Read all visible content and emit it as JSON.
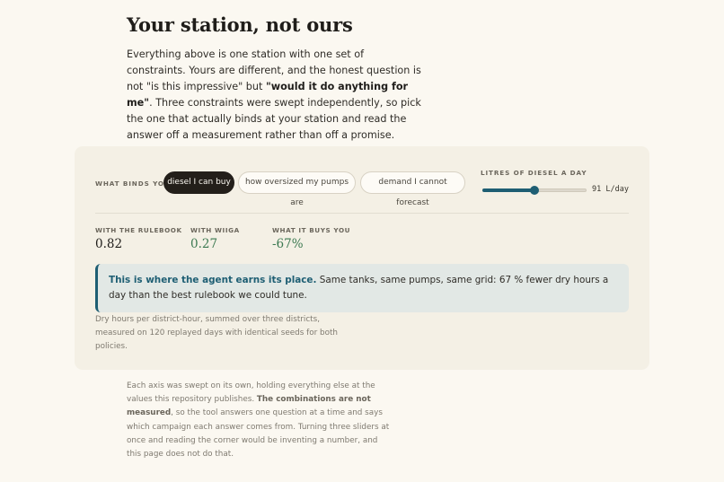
{
  "section": {
    "title": "Your station, not ours",
    "intro_1": "Everything above is one station with one set of constraints. Yours are different, and the honest question is not \"is this impressive\" but ",
    "intro_bold": "\"would it do anything for me\"",
    "intro_2": ". Three constraints were swept independently, so pick the one that actually binds at your station and read the answer off a measurement rather than off a promise."
  },
  "panel": {
    "binds_label": "WHAT BINDS YOU",
    "options": [
      {
        "label": "diesel I can buy",
        "active": true
      },
      {
        "label": "how oversized my pumps are",
        "active": false
      },
      {
        "label": "demand I cannot forecast",
        "active": false
      }
    ],
    "slider": {
      "label": "LITRES OF DIESEL A DAY",
      "value": 91,
      "unit": "L/day",
      "display": "91 L/day",
      "fraction": 0.5
    },
    "metrics": [
      {
        "label": "WITH THE RULEBOOK",
        "value": "0.82"
      },
      {
        "label": "WITH WIIGA",
        "value": "0.27"
      },
      {
        "label": "WHAT IT BUYS YOU",
        "value": "-67%"
      }
    ],
    "callout": {
      "lead": "This is where the agent earns its place.",
      "body": " Same tanks, same pumps, same grid: 67 % fewer dry hours a day than the best rulebook we could tune."
    },
    "footnote": "Dry hours per district-hour, summed over three districts, measured on 120 replayed days with identical seeds for both policies."
  },
  "closing": {
    "text_1": "Each axis was swept on its own, holding everything else at the values this repository publishes. ",
    "bold": "The combinations are not measured",
    "text_2": ", so the tool answers one question at a time and says which campaign each answer comes from. Turning three sliders at once and reading the corner would be inventing a number, and this page does not do that."
  },
  "colors": {
    "accent": "#1e5e73",
    "positive": "#3d7a52",
    "chip_active": "#231f1a",
    "background": "#fbf8f1",
    "card": "#f4f0e5"
  }
}
